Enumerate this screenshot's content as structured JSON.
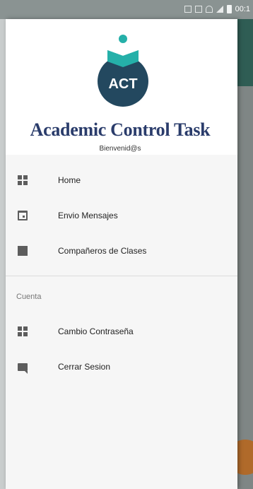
{
  "status_bar": {
    "time": "00:1",
    "icons": [
      "mute-icon",
      "nfc-icon",
      "wifi-icon",
      "signal-icon",
      "battery-icon"
    ]
  },
  "drawer": {
    "logo_text": "ACT",
    "app_title": "Academic Control Task",
    "welcome": "Bienvenid@s",
    "main_items": [
      {
        "label": "Home",
        "icon": "dashboard-icon"
      },
      {
        "label": "Envio Mensajes",
        "icon": "calendar-icon"
      },
      {
        "label": "Compañeros de Clases",
        "icon": "square-icon"
      }
    ],
    "section_title": "Cuenta",
    "account_items": [
      {
        "label": "Cambio Contraseña",
        "icon": "dashboard-icon"
      },
      {
        "label": "Cerrar Sesion",
        "icon": "chat-icon"
      }
    ]
  },
  "colors": {
    "title": "#2a3c6b",
    "logo_circle": "#23485f",
    "logo_book": "#25b0a9",
    "drawer_bg": "#f6f6f6",
    "header_bg": "#ffffff"
  }
}
